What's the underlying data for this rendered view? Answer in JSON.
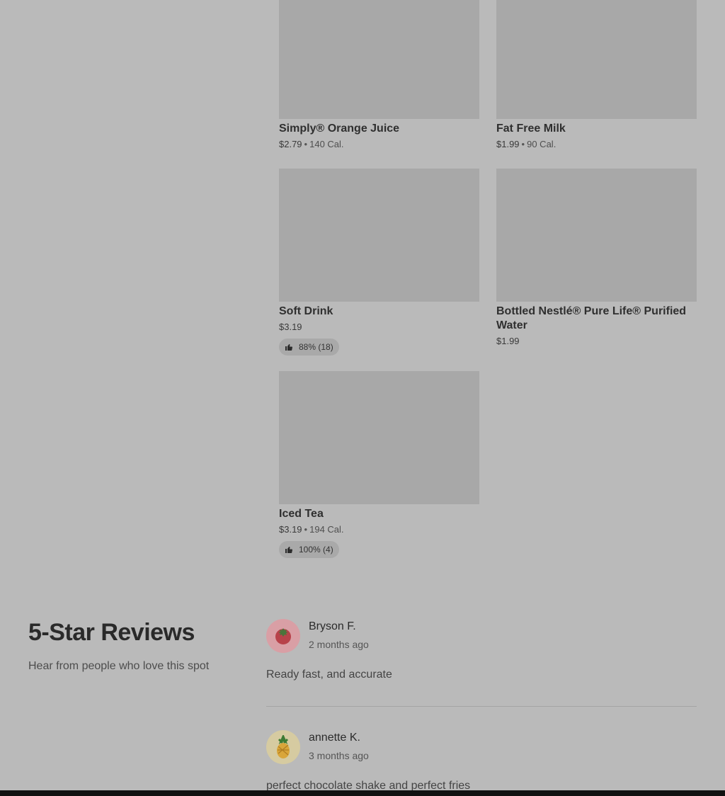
{
  "menu_items": [
    {
      "name": "Simply® Orange Juice",
      "price": "$2.79",
      "sep": "•",
      "calories": "140 Cal.",
      "rating": ""
    },
    {
      "name": "Fat Free Milk",
      "price": "$1.99",
      "sep": "•",
      "calories": "90 Cal.",
      "rating": ""
    },
    {
      "name": "Soft Drink",
      "price": "$3.19",
      "sep": "",
      "calories": "",
      "rating": "88% (18)"
    },
    {
      "name": "Bottled Nestlé® Pure Life® Purified Water",
      "price": "$1.99",
      "sep": "",
      "calories": "",
      "rating": ""
    },
    {
      "name": "Iced Tea",
      "price": "$3.19",
      "sep": "•",
      "calories": "194 Cal.",
      "rating": "100% (4)"
    }
  ],
  "reviews_section": {
    "title": "5-Star Reviews",
    "subtitle": "Hear from people who love this spot"
  },
  "reviews": [
    {
      "author": "Bryson F.",
      "date": "2 months ago",
      "text": "Ready fast, and accurate",
      "avatar_icon": "tomato-icon",
      "avatar_bg": "#d99fa5"
    },
    {
      "author": "annette K.",
      "date": "3 months ago",
      "text": "perfect chocolate shake and perfect fries",
      "avatar_icon": "pineapple-icon",
      "avatar_bg": "#d6cba1"
    }
  ],
  "colors": {
    "overlay_bg": "#bababa",
    "image_placeholder": "#a8a8a8",
    "badge_bg": "#a9a9a9"
  }
}
